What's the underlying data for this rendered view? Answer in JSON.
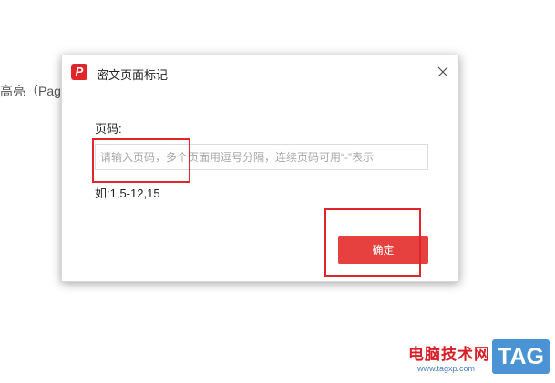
{
  "background": {
    "text": "高亮（Pag"
  },
  "dialog": {
    "title": "密文页面标记",
    "app_icon_letter": "P",
    "field_label": "页码:",
    "input": {
      "value": "",
      "placeholder": "请输入页码，多个页面用逗号分隔，连续页码可用“-”表示"
    },
    "example": "如:1,5-12,15",
    "ok_label": "确定"
  },
  "watermark": {
    "brand": "电脑技术网",
    "url": "www.tagxp.com",
    "tag": "TAG"
  },
  "colors": {
    "accent": "#e6403f",
    "highlight": "#e0262b",
    "tag_blue": "#4a93d5"
  }
}
